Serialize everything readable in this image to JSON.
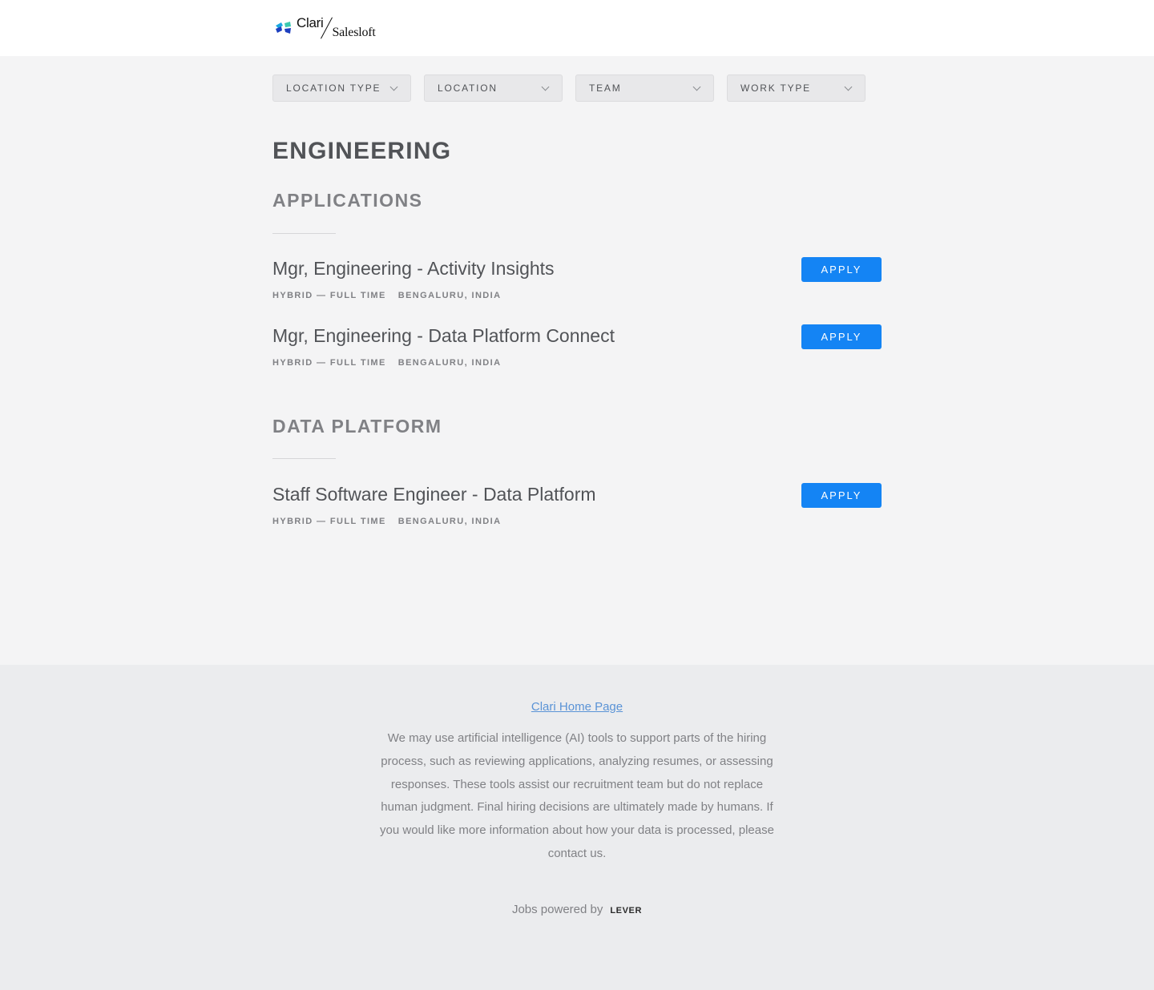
{
  "header": {
    "logo": {
      "brand_primary": "Clari",
      "brand_secondary": "Salesloft",
      "icon": "clari-logo-icon",
      "colors": [
        "#1aa7e0",
        "#1d3fbf",
        "#3bc9b0"
      ]
    }
  },
  "filters": [
    {
      "label": "LOCATION TYPE",
      "icon": "chevron-down-icon"
    },
    {
      "label": "LOCATION",
      "icon": "chevron-down-icon"
    },
    {
      "label": "TEAM",
      "icon": "chevron-down-icon"
    },
    {
      "label": "WORK TYPE",
      "icon": "chevron-down-icon"
    }
  ],
  "department": "ENGINEERING",
  "teams": [
    {
      "name": "APPLICATIONS",
      "postings": [
        {
          "title": "Mgr, Engineering - Activity Insights",
          "commitment": "HYBRID — FULL TIME",
          "location": "BENGALURU, INDIA",
          "apply_label": "APPLY"
        },
        {
          "title": "Mgr, Engineering - Data Platform Connect",
          "commitment": "HYBRID — FULL TIME",
          "location": "BENGALURU, INDIA",
          "apply_label": "APPLY"
        }
      ]
    },
    {
      "name": "DATA PLATFORM",
      "postings": [
        {
          "title": "Staff Software Engineer - Data Platform",
          "commitment": "HYBRID — FULL TIME",
          "location": "BENGALURU, INDIA",
          "apply_label": "APPLY"
        }
      ]
    }
  ],
  "footer": {
    "home_link": "Clari Home Page",
    "disclaimer": "We may use artificial intelligence (AI) tools to support parts of the hiring process, such as reviewing applications, analyzing resumes, or assessing responses. These tools assist our recruitment team but do not replace human judgment. Final hiring decisions are ultimately made by humans. If you would like more information about how your data is processed, please contact us.",
    "powered_by": "Jobs powered by",
    "lever": "LEVER"
  },
  "colors": {
    "accent": "#1484f4",
    "link": "#5a93d6",
    "page_bg": "#f4f4f5",
    "footer_bg": "#ebecee"
  }
}
